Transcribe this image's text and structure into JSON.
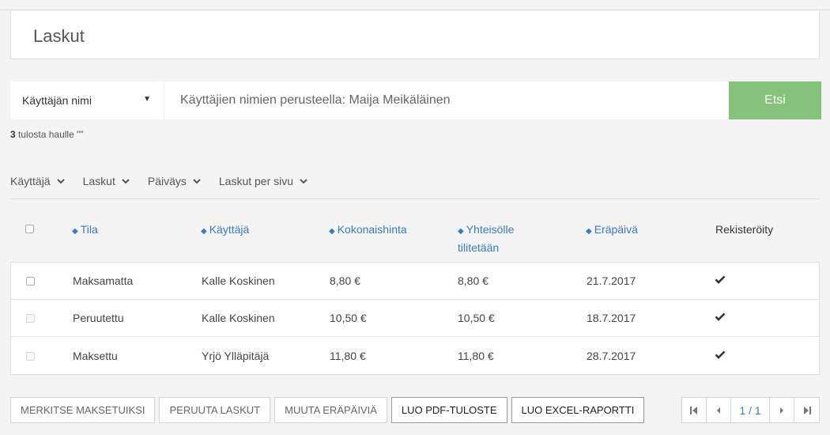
{
  "page": {
    "title": "Laskut"
  },
  "search": {
    "field_select": "Käyttäjän nimi",
    "placeholder": "Käyttäjien nimien perusteella: Maija Meikäläinen",
    "button_label": "Etsi"
  },
  "result_summary": {
    "count": "3",
    "text": "tulosta  haulle",
    "query": "\"\""
  },
  "filters": [
    {
      "label": "Käyttäjä"
    },
    {
      "label": "Laskut"
    },
    {
      "label": "Päiväys"
    },
    {
      "label": "Laskut per sivu"
    }
  ],
  "table": {
    "columns": {
      "status": "Tila",
      "user": "Käyttäjä",
      "total": "Kokonaishinta",
      "payout": "Yhteisölle tilitetään",
      "due": "Eräpäivä",
      "registered": "Rekisteröity"
    },
    "rows": [
      {
        "status": "Maksamatta",
        "user": "Kalle Koskinen",
        "total": "8,80 €",
        "payout": "8,80 €",
        "due": "21.7.2017",
        "registered": true
      },
      {
        "status": "Peruutettu",
        "user": "Kalle Koskinen",
        "total": "10,50 €",
        "payout": "10,50 €",
        "due": "18.7.2017",
        "registered": true
      },
      {
        "status": "Maksettu",
        "user": "Yrjö Ylläpitäjä",
        "total": "11,80 €",
        "payout": "11,80 €",
        "due": "28.7.2017",
        "registered": true
      }
    ]
  },
  "actions": {
    "mark_paid": "MERKITSE MAKSETUIKSI",
    "cancel": "PERUUTA LASKUT",
    "change_due": "MUUTA ERÄPÄIVIÄ",
    "pdf": "LUO PDF-TULOSTE",
    "excel": "LUO EXCEL-RAPORTTI"
  },
  "pagination": {
    "info": "1 / 1"
  },
  "colors": {
    "accent": "#3a7bbf",
    "search_button": "#86c37a"
  }
}
